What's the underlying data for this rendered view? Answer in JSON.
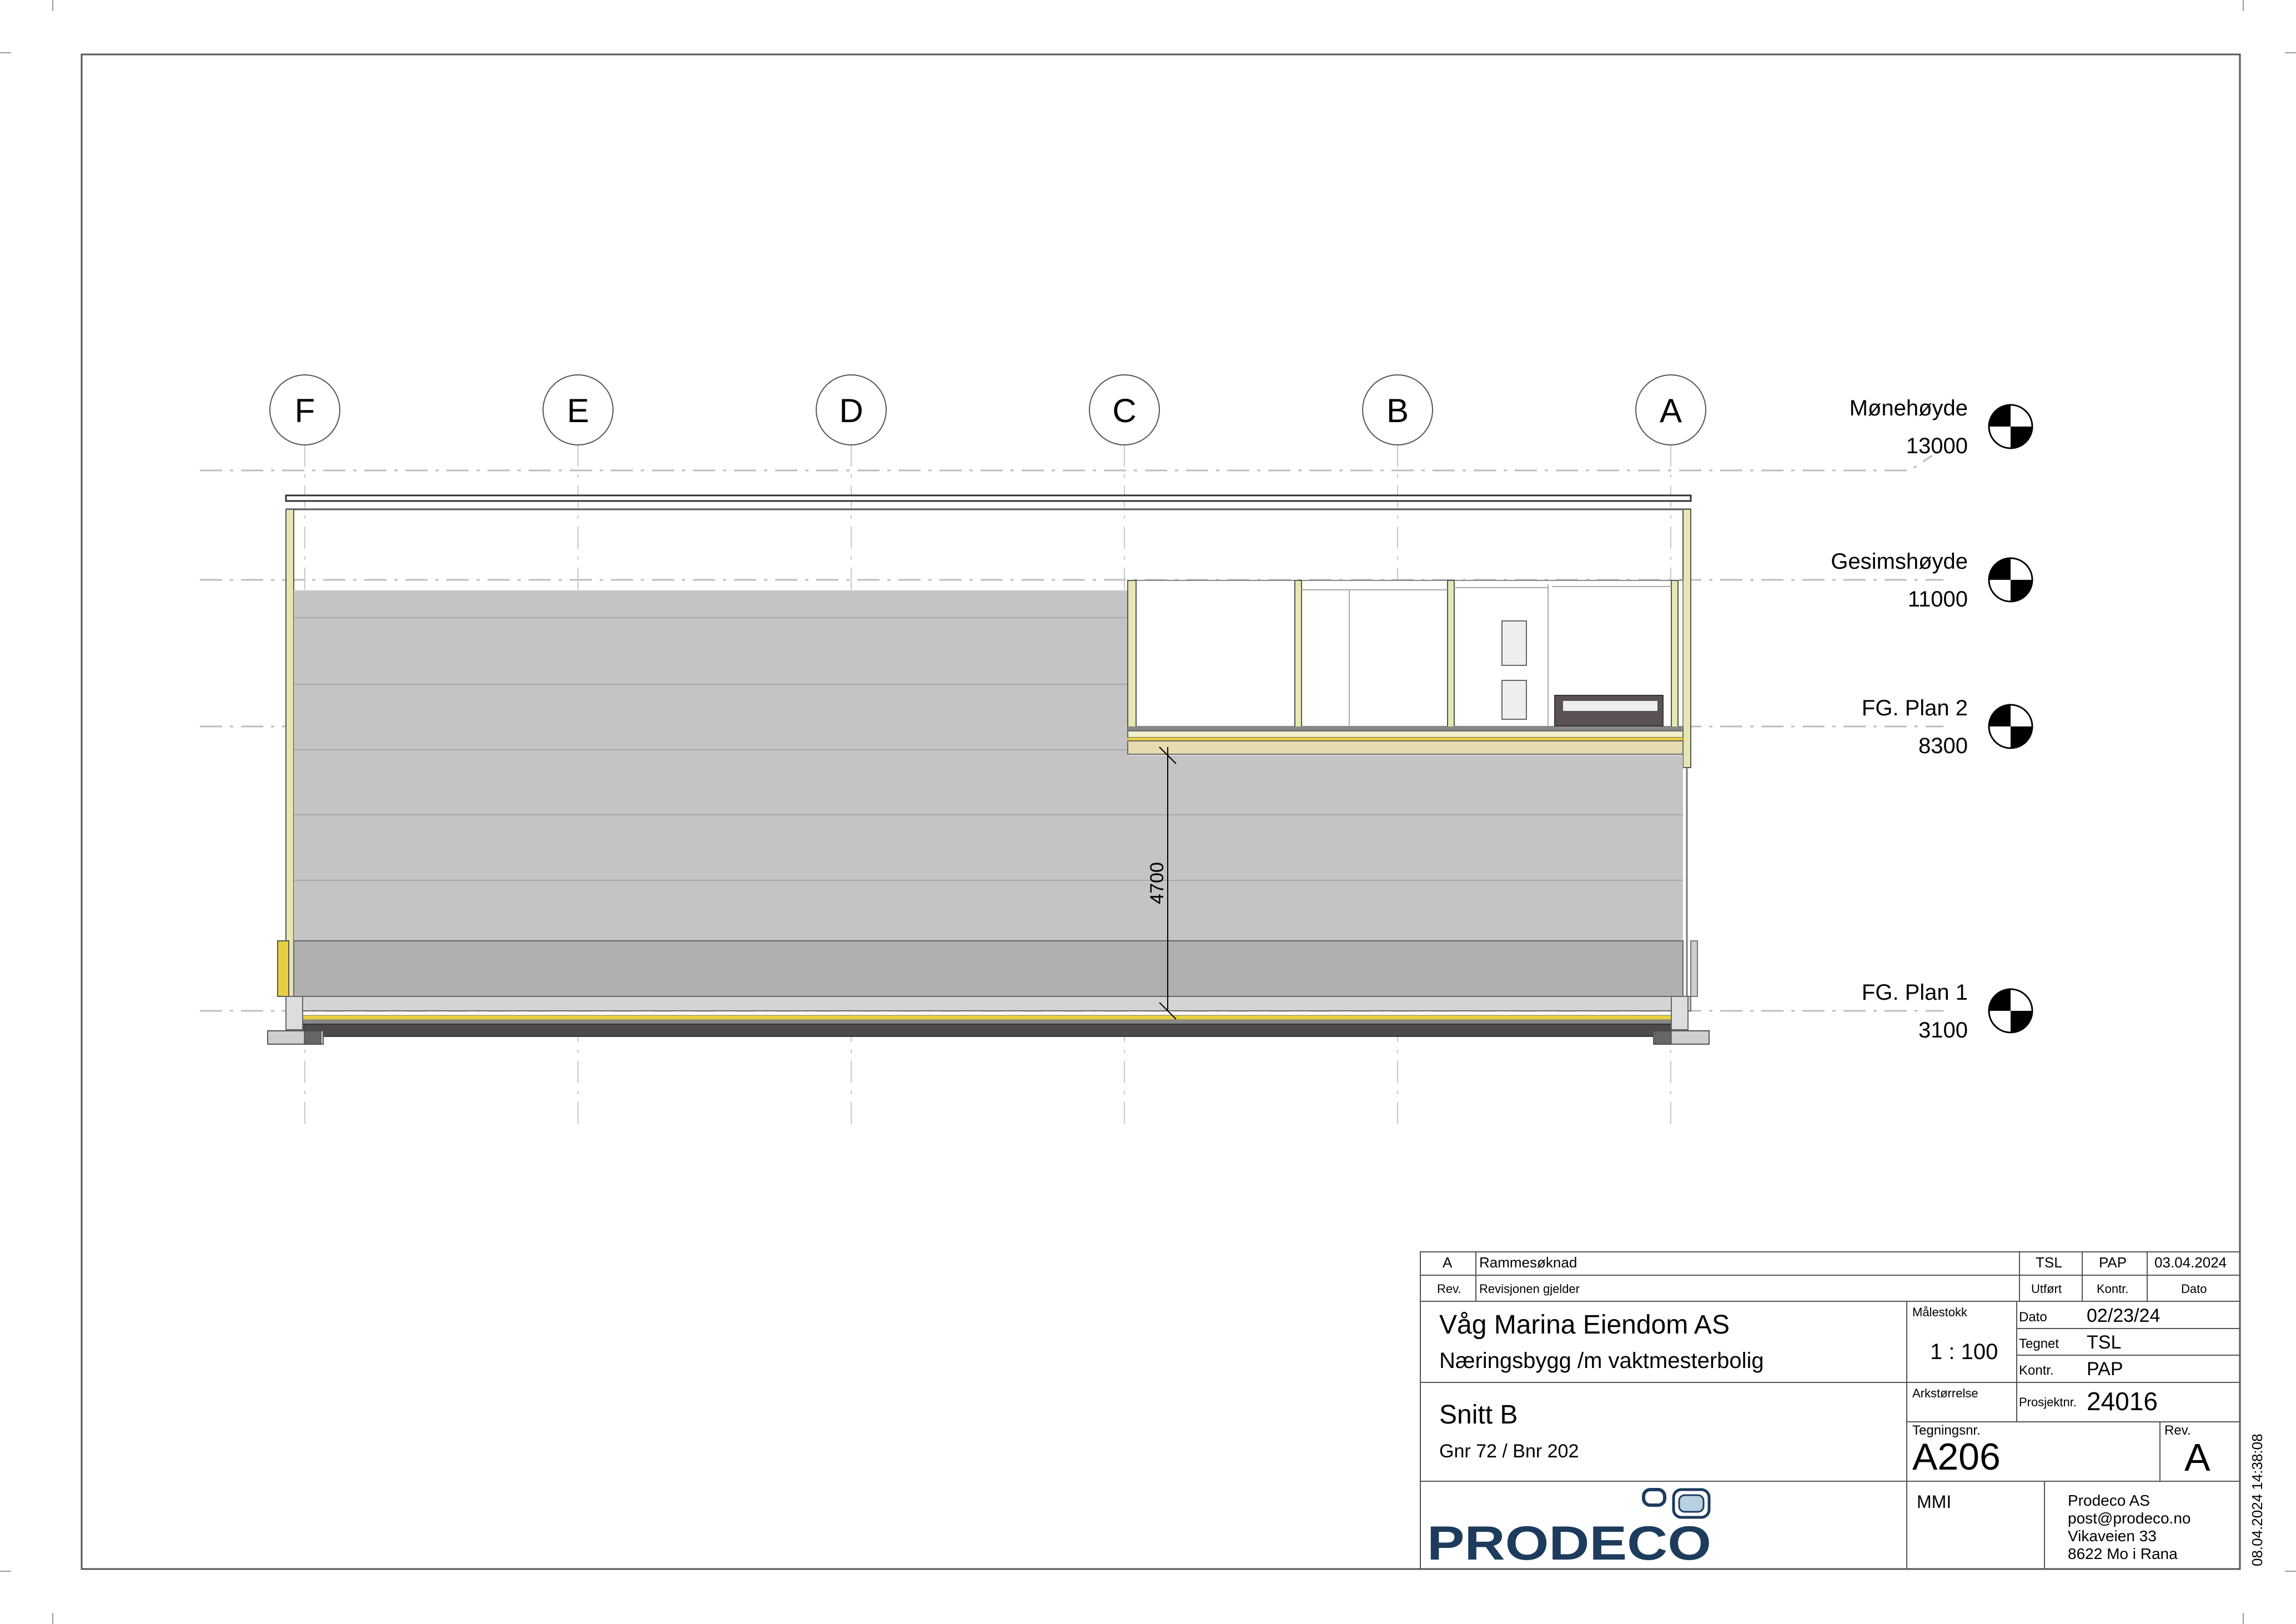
{
  "grid_axes": [
    "F",
    "E",
    "D",
    "C",
    "B",
    "A"
  ],
  "levels": [
    {
      "name": "Mønehøyde",
      "value": "13000"
    },
    {
      "name": "Gesimshøyde",
      "value": "11000"
    },
    {
      "name": "FG. Plan 2",
      "value": "8300"
    },
    {
      "name": "FG. Plan 1",
      "value": "3100"
    }
  ],
  "dimension": "4700",
  "title_block": {
    "revision_row": {
      "rev": "A",
      "description": "Rammesøknad",
      "by": "TSL",
      "checked": "PAP",
      "date": "03.04.2024"
    },
    "revision_header": {
      "rev": "Rev.",
      "description": "Revisjonen gjelder",
      "by": "Utført",
      "checked": "Kontr.",
      "date": "Dato"
    },
    "client": "Våg Marina Eiendom AS",
    "project": "Næringsbygg /m vaktmesterbolig",
    "scale_label": "Målestokk",
    "scale": "1 : 100",
    "date_label": "Dato",
    "date": "02/23/24",
    "drawn_label": "Tegnet",
    "drawn": "TSL",
    "checked_label": "Kontr.",
    "checked": "PAP",
    "sheet_size_label": "Arkstørrelse",
    "project_no_label": "Prosjektnr.",
    "project_no": "24016",
    "drawing_title": "Snitt B",
    "property": "Gnr 72 / Bnr 202",
    "drawing_no_label": "Tegningsnr.",
    "drawing_no": "A206",
    "rev_label": "Rev.",
    "rev": "A",
    "mmi": "MMI",
    "company": "Prodeco AS",
    "email": "post@prodeco.no",
    "street": "Vikaveien 33",
    "city": "8622 Mo i Rana",
    "logo_text": "PRODECO"
  },
  "print_stamp": "08.04.2024 14:38:08"
}
